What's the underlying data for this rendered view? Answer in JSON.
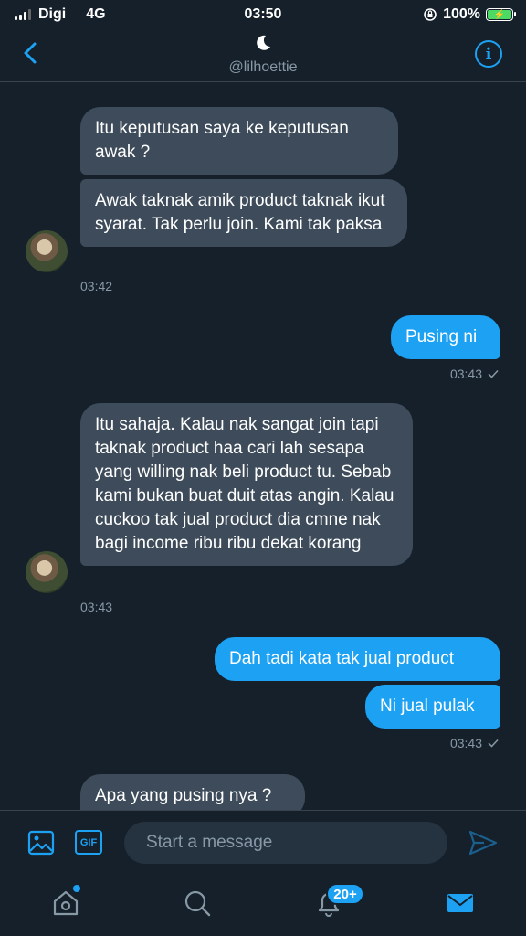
{
  "status_bar": {
    "carrier": "Digi",
    "network": "4G",
    "time": "03:50",
    "battery": "100%"
  },
  "header": {
    "handle": "@lilhoettie",
    "back_icon": "chevron-left-icon",
    "info_icon": "info-icon"
  },
  "messages": [
    {
      "side": "in",
      "text": "Itu keputusan saya ke keputusan awak ?"
    },
    {
      "side": "in",
      "text": "Awak taknak amik product taknak ikut syarat. Tak perlu join. Kami tak paksa"
    },
    {
      "side": "out",
      "text": "Pusing ni"
    },
    {
      "side": "in",
      "text": "Itu sahaja. Kalau nak sangat join tapi taknak product haa cari lah sesapa yang willing nak beli product tu. Sebab kami bukan buat duit atas angin. Kalau cuckoo tak jual product dia cmne nak bagi income ribu ribu dekat korang"
    },
    {
      "side": "out",
      "text": "Dah tadi kata tak jual product"
    },
    {
      "side": "out",
      "text": "Ni jual pulak"
    },
    {
      "side": "in",
      "text": "Apa yang pusing nya ?"
    }
  ],
  "timestamps": [
    "03:42",
    "03:43",
    "03:43",
    "03:43"
  ],
  "composer": {
    "placeholder": "Start a message",
    "gif_label": "GIF"
  },
  "tabbar": {
    "notification_badge": "20+"
  },
  "colors": {
    "background": "#15202b",
    "accent": "#1da1f2",
    "incoming_bubble": "#3d4b5a",
    "muted_text": "#8899a6"
  }
}
